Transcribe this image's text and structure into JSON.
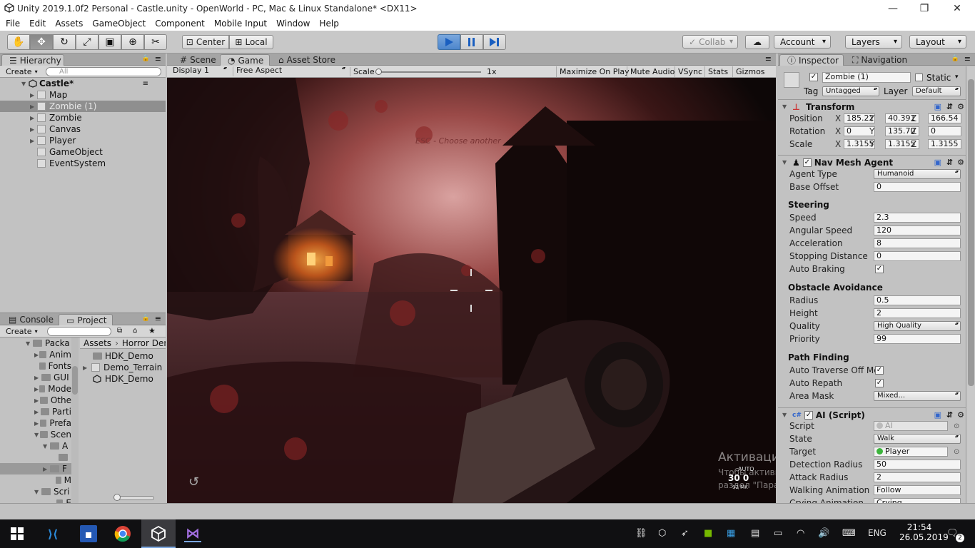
{
  "window": {
    "title": "Unity 2019.1.0f2 Personal - Castle.unity - OpenWorld - PC, Mac & Linux Standalone* <DX11>"
  },
  "menu": [
    "File",
    "Edit",
    "Assets",
    "GameObject",
    "Component",
    "Mobile Input",
    "Window",
    "Help"
  ],
  "toolbar": {
    "center": "Center",
    "local": "Local",
    "collab": "Collab",
    "account": "Account",
    "layers": "Layers",
    "layout": "Layout"
  },
  "hierarchy": {
    "tab": "Hierarchy",
    "create": "Create",
    "search_placeholder": "All",
    "scene": "Castle*",
    "items": [
      {
        "label": "Map",
        "expandable": true
      },
      {
        "label": "Zombie (1)",
        "expandable": true,
        "selected": true
      },
      {
        "label": "Zombie",
        "expandable": true
      },
      {
        "label": "Canvas",
        "expandable": true
      },
      {
        "label": "Player",
        "expandable": true
      },
      {
        "label": "GameObject",
        "expandable": false
      },
      {
        "label": "EventSystem",
        "expandable": false
      }
    ]
  },
  "project": {
    "tabs": [
      "Console",
      "Project"
    ],
    "create": "Create",
    "tree": [
      "Packa",
      "Anim",
      "Fonts",
      "GUI",
      "Mode",
      "Othe",
      "Parti",
      "Prefa",
      "Scen",
      "A",
      "",
      "F",
      "M",
      "Scri",
      "E"
    ],
    "breadcrumb": [
      "Assets",
      "Horror Dem"
    ],
    "assets": [
      "HDK_Demo",
      "Demo_Terrain",
      "HDK_Demo"
    ]
  },
  "views": {
    "tabs": [
      "Scene",
      "Game",
      "Asset Store"
    ],
    "display": "Display 1",
    "aspect": "Free Aspect",
    "scale_label": "Scale",
    "scale_value": "1x",
    "options": [
      "Maximize On Play",
      "Mute Audio",
      "VSync",
      "Stats",
      "Gizmos"
    ]
  },
  "game": {
    "overlay_text": "ESC - Choose another",
    "ammo": "30",
    "ammo_reserve": "0",
    "fire_mode": "AUTO",
    "hud_small": "92 MK",
    "watermark_title": "Активация Windows",
    "watermark_line1": "Чтобы активировать Windows",
    "watermark_line2": "раздел \"Параметры\"."
  },
  "inspector": {
    "tabs": [
      "Inspector",
      "Navigation"
    ],
    "name": "Zombie (1)",
    "static_label": "Static",
    "tag_label": "Tag",
    "tag": "Untagged",
    "layer_label": "Layer",
    "layer": "Default",
    "transform": {
      "title": "Transform",
      "position": {
        "label": "Position",
        "x": "185.22",
        "y": "40.391",
        "z": "166.54"
      },
      "rotation": {
        "label": "Rotation",
        "x": "0",
        "y": "135.70",
        "z": "0"
      },
      "scale": {
        "label": "Scale",
        "x": "1.3155",
        "y": "1.3155",
        "z": "1.3155"
      }
    },
    "nav": {
      "title": "Nav Mesh Agent",
      "agent_type_label": "Agent Type",
      "agent_type": "Humanoid",
      "base_offset_label": "Base Offset",
      "base_offset": "0",
      "steering": "Steering",
      "speed_label": "Speed",
      "speed": "2.3",
      "angular_label": "Angular Speed",
      "angular": "120",
      "accel_label": "Acceleration",
      "accel": "8",
      "stopping_label": "Stopping Distance",
      "stopping": "0",
      "braking_label": "Auto Braking",
      "obstacle": "Obstacle Avoidance",
      "radius_label": "Radius",
      "radius": "0.5",
      "height_label": "Height",
      "height": "2",
      "quality_label": "Quality",
      "quality": "High Quality",
      "priority_label": "Priority",
      "priority": "99",
      "path": "Path Finding",
      "traverse_label": "Auto Traverse Off Me",
      "repath_label": "Auto Repath",
      "area_label": "Area Mask",
      "area": "Mixed..."
    },
    "ai": {
      "title": "AI (Script)",
      "script_label": "Script",
      "script": "AI",
      "state_label": "State",
      "state": "Walk",
      "target_label": "Target",
      "target": "Player",
      "detect_label": "Detection Radius",
      "detect": "50",
      "attack_label": "Attack Radius",
      "attack": "2",
      "walk_label": "Walking Animation",
      "walk": "Follow",
      "cry_label": "Crying Animation",
      "cry": "Crying"
    }
  },
  "taskbar": {
    "lang": "ENG",
    "time": "21:54",
    "date": "26.05.2019",
    "notif_count": "2"
  },
  "colors": {
    "accent": "#3d7bd1",
    "panel": "#c2c2c2",
    "selected": "#8f8f8f"
  }
}
